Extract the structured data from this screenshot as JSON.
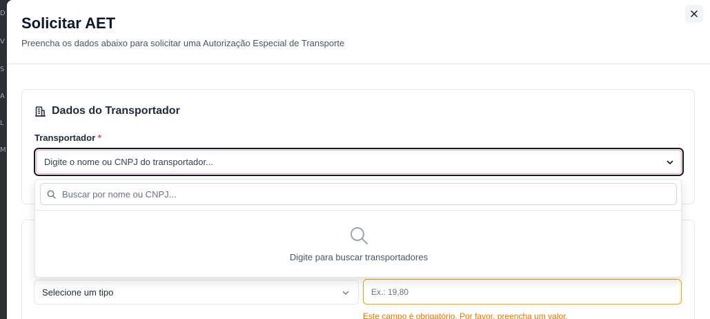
{
  "backdrop_letters": [
    "D",
    "V",
    "S",
    "A",
    "L",
    "M"
  ],
  "modal": {
    "title": "Solicitar AET",
    "subtitle": "Preencha os dados abaixo para solicitar uma Autorização Especial de Transporte",
    "close_icon": "close-icon"
  },
  "transportador_section": {
    "title": "Dados do Transportador",
    "icon": "building-icon",
    "field_label": "Transportador",
    "required_mark": "*",
    "placeholder": "Digite o nome ou CNPJ do transportador...",
    "dropdown": {
      "search_placeholder": "Buscar por nome ou CNPJ...",
      "empty_message": "Digite para buscar transportadores"
    }
  },
  "vehicle_section": {
    "select_value": "Selecione um tipo",
    "input_placeholder": "Ex.: 19,80",
    "error_message": "Este campo é obrigatório. Por favor, preencha um valor."
  },
  "colors": {
    "accent_error": "#ef4444",
    "warning_border": "#f59e0b",
    "warning_text": "#d97706"
  }
}
